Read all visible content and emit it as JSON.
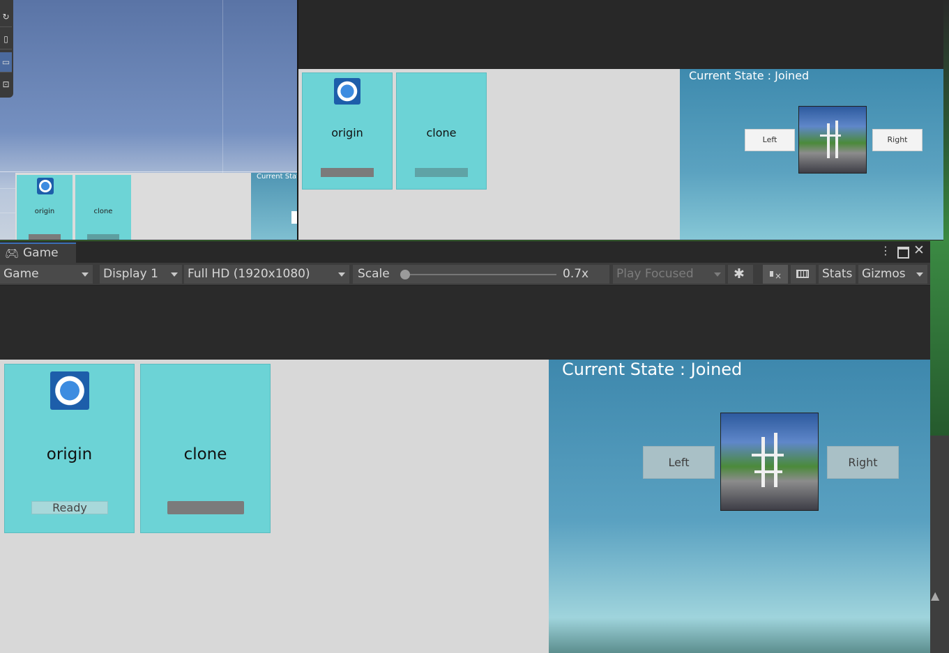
{
  "scene_view": {
    "mini_origin_label": "origin",
    "mini_clone_label": "clone",
    "mini_state_text": "Current Stat"
  },
  "top_game": {
    "origin_label": "origin",
    "clone_label": "clone",
    "state_text": "Current State : Joined",
    "left_label": "Left",
    "right_label": "Right"
  },
  "game_window": {
    "tab_title": "Game",
    "toolbar": {
      "view_dropdown": "Game",
      "display_dropdown": "Display 1",
      "resolution_dropdown": "Full HD (1920x1080)",
      "scale_label": "Scale",
      "scale_value": "0.7x",
      "scale_slider_fraction": 0.0,
      "play_mode_dropdown": "Play Focused",
      "stats_label": "Stats",
      "gizmos_label": "Gizmos"
    },
    "origin_label": "origin",
    "clone_label": "clone",
    "ready_label": "Ready",
    "state_text": "Current State : Joined",
    "left_label": "Left",
    "right_label": "Right"
  },
  "icons": [
    "gamepad-icon",
    "kebab-menu-icon",
    "maximize-icon",
    "close-icon",
    "bug-icon",
    "mute-audio-icon",
    "keyboard-icon",
    "spinner-icon",
    "game-thumbnail-icon"
  ],
  "colors": {
    "card": "#6cd3d6",
    "sky": "#5aa1c1",
    "tab_accent": "#3b6fb6"
  }
}
